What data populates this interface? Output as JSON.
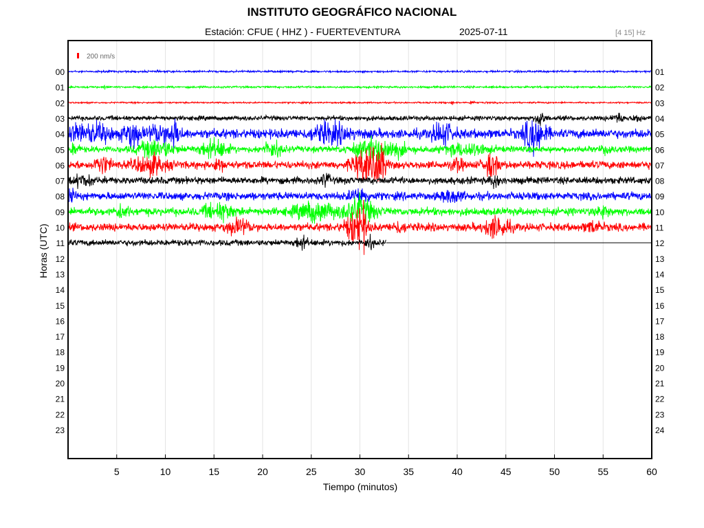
{
  "header": {
    "title": "INSTITUTO GEOGRÁFICO NACIONAL",
    "station": "Estación:  CFUE ( HHZ ) - FUERTEVENTURA",
    "date": "2025-07-11",
    "band": "[4 15] Hz"
  },
  "scale_bar": {
    "label": "200 nm/s",
    "color": "#ff0000"
  },
  "chart_data": {
    "type": "line",
    "title": "INSTITUTO GEOGRÁFICO NACIONAL",
    "xlabel": "Tiempo (minutos)",
    "ylabel": "Horas (UTC)",
    "xlim": [
      0,
      60
    ],
    "x_ticks": [
      5,
      10,
      15,
      20,
      25,
      30,
      35,
      40,
      45,
      50,
      55,
      60
    ],
    "x_tick_labels": [
      "5",
      "10",
      "15",
      "20",
      "25",
      "30",
      "35",
      "40",
      "45",
      "50",
      "55",
      "60"
    ],
    "grid": "vertical",
    "left_hour_labels": [
      "00",
      "01",
      "02",
      "03",
      "04",
      "05",
      "06",
      "07",
      "08",
      "09",
      "10",
      "11",
      "12",
      "13",
      "14",
      "15",
      "16",
      "17",
      "18",
      "19",
      "20",
      "21",
      "22",
      "23"
    ],
    "right_hour_labels": [
      "01",
      "02",
      "03",
      "04",
      "05",
      "06",
      "07",
      "08",
      "09",
      "10",
      "11",
      "12",
      "13",
      "14",
      "15",
      "16",
      "17",
      "18",
      "19",
      "20",
      "21",
      "22",
      "23",
      "24"
    ],
    "color_cycle": [
      "#0000ff",
      "#00ff00",
      "#ff0000",
      "#000000"
    ],
    "series": [
      {
        "hour": 0,
        "color": "#0000ff",
        "noise": 0.25,
        "end_min": 60,
        "events": []
      },
      {
        "hour": 1,
        "color": "#00ff00",
        "noise": 0.25,
        "end_min": 60,
        "events": [
          [
            3.8,
            0.15,
            0.5
          ]
        ]
      },
      {
        "hour": 2,
        "color": "#ff0000",
        "noise": 0.2,
        "end_min": 60,
        "events": [
          [
            39.5,
            0.15,
            0.4
          ],
          [
            41.5,
            0.2,
            0.5
          ],
          [
            43,
            0.1,
            0.3
          ]
        ]
      },
      {
        "hour": 3,
        "color": "#000000",
        "noise": 0.6,
        "end_min": 60,
        "events": [
          [
            48.5,
            0.4,
            2.5
          ],
          [
            56.5,
            0.6,
            1.0
          ],
          [
            58.5,
            0.4,
            0.8
          ]
        ]
      },
      {
        "hour": 4,
        "color": "#0000ff",
        "noise": 1.2,
        "end_min": 60,
        "events": [
          [
            3,
            1.5,
            1.8
          ],
          [
            6.5,
            0.8,
            3.0
          ],
          [
            9.5,
            1.2,
            2.0
          ],
          [
            11,
            0.6,
            2.5
          ],
          [
            27,
            2.0,
            2.0
          ],
          [
            38.5,
            1.0,
            2.5
          ],
          [
            48,
            1.0,
            4.5
          ],
          [
            1,
            1.0,
            1.5
          ]
        ]
      },
      {
        "hour": 5,
        "color": "#00ff00",
        "noise": 0.8,
        "end_min": 60,
        "events": [
          [
            0.7,
            0.4,
            1.5
          ],
          [
            9,
            1.8,
            2.2
          ],
          [
            15,
            1.5,
            2.0
          ],
          [
            21,
            1.0,
            1.8
          ],
          [
            32,
            2.5,
            2.5
          ],
          [
            41,
            2.0,
            1.5
          ],
          [
            55.5,
            0.5,
            1.2
          ]
        ]
      },
      {
        "hour": 6,
        "color": "#ff0000",
        "noise": 1.0,
        "end_min": 60,
        "events": [
          [
            3.5,
            0.8,
            2.0
          ],
          [
            8.5,
            1.5,
            2.2
          ],
          [
            15.5,
            0.6,
            1.2
          ],
          [
            30.5,
            1.2,
            3.5
          ],
          [
            32,
            0.6,
            5.0
          ],
          [
            40,
            0.5,
            1.5
          ],
          [
            43.5,
            0.8,
            2.5
          ]
        ]
      },
      {
        "hour": 7,
        "color": "#000000",
        "noise": 0.9,
        "end_min": 60,
        "events": [
          [
            1.5,
            1.0,
            1.2
          ],
          [
            26.5,
            0.4,
            1.5
          ],
          [
            44,
            0.6,
            1.3
          ]
        ]
      },
      {
        "hour": 8,
        "color": "#0000ff",
        "noise": 1.0,
        "end_min": 60,
        "events": [
          [
            0.3,
            0.4,
            1.5
          ],
          [
            30,
            1.0,
            1.5
          ],
          [
            39.5,
            1.0,
            1.3
          ]
        ]
      },
      {
        "hour": 9,
        "color": "#00ff00",
        "noise": 1.0,
        "end_min": 60,
        "events": [
          [
            5.5,
            0.6,
            1.5
          ],
          [
            15.5,
            1.5,
            1.8
          ],
          [
            25.5,
            2.0,
            2.2
          ],
          [
            30,
            1.5,
            3.0
          ],
          [
            55,
            0.6,
            1.3
          ]
        ]
      },
      {
        "hour": 10,
        "color": "#ff0000",
        "noise": 1.0,
        "end_min": 60,
        "events": [
          [
            17.5,
            1.2,
            1.5
          ],
          [
            29.5,
            1.0,
            3.5
          ],
          [
            30.2,
            0.4,
            4.5
          ],
          [
            34,
            0.6,
            1.3
          ],
          [
            44,
            1.2,
            2.5
          ],
          [
            54,
            0.8,
            1.2
          ]
        ]
      },
      {
        "hour": 11,
        "color": "#000000",
        "noise": 0.8,
        "end_min": 32.7,
        "events": [
          [
            24,
            0.6,
            1.3
          ],
          [
            31,
            0.4,
            1.3
          ]
        ]
      }
    ]
  }
}
